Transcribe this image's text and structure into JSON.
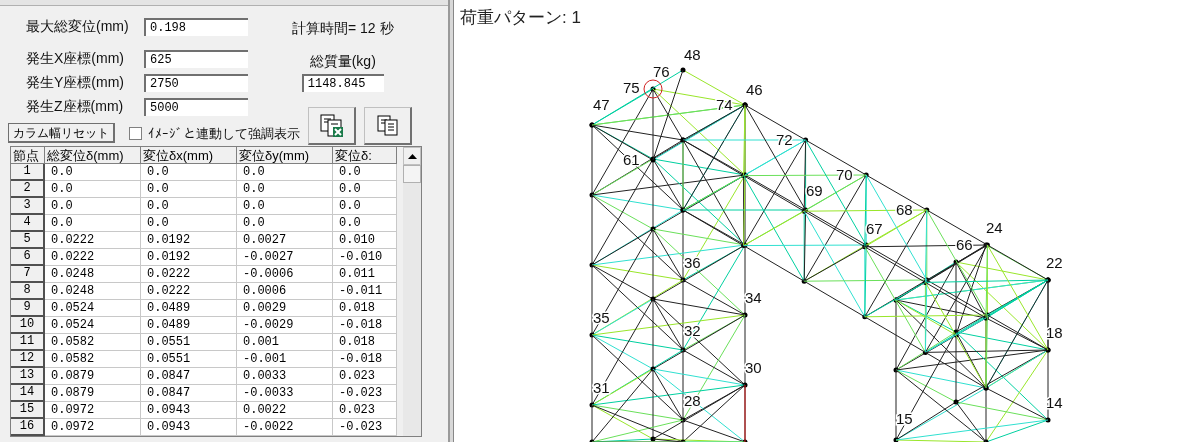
{
  "result_fields": [
    {
      "label": "最大総変位(mm)",
      "value": "0.198"
    },
    {
      "label": "発生X座標(mm)",
      "value": "625"
    },
    {
      "label": "発生Y座標(mm)",
      "value": "2750"
    },
    {
      "label": "発生Z座標(mm)",
      "value": "5000"
    }
  ],
  "calc_time": "計算時間= 12 秒",
  "mass": {
    "label": "総質量(kg)",
    "value": "1148.845"
  },
  "reset_button": "カラム幅リセット",
  "highlight_checkbox": {
    "label": "ｲﾒｰｼﾞと連動して強調表示",
    "checked": false
  },
  "table": {
    "columns": [
      "節点",
      "総変位δ(mm)",
      "変位δx(mm)",
      "変位δy(mm)",
      "変位δ:"
    ],
    "rows": [
      [
        "1",
        "0.0",
        "0.0",
        "0.0",
        "0.0"
      ],
      [
        "2",
        "0.0",
        "0.0",
        "0.0",
        "0.0"
      ],
      [
        "3",
        "0.0",
        "0.0",
        "0.0",
        "0.0"
      ],
      [
        "4",
        "0.0",
        "0.0",
        "0.0",
        "0.0"
      ],
      [
        "5",
        "0.0222",
        "0.0192",
        "0.0027",
        "0.010"
      ],
      [
        "6",
        "0.0222",
        "0.0192",
        "-0.0027",
        "-0.010"
      ],
      [
        "7",
        "0.0248",
        "0.0222",
        "-0.0006",
        "0.011"
      ],
      [
        "8",
        "0.0248",
        "0.0222",
        "0.0006",
        "-0.011"
      ],
      [
        "9",
        "0.0524",
        "0.0489",
        "0.0029",
        "0.018"
      ],
      [
        "10",
        "0.0524",
        "0.0489",
        "-0.0029",
        "-0.018"
      ],
      [
        "11",
        "0.0582",
        "0.0551",
        "0.001",
        "0.018"
      ],
      [
        "12",
        "0.0582",
        "0.0551",
        "-0.001",
        "-0.018"
      ],
      [
        "13",
        "0.0879",
        "0.0847",
        "0.0033",
        "0.023"
      ],
      [
        "14",
        "0.0879",
        "0.0847",
        "-0.0033",
        "-0.023"
      ],
      [
        "15",
        "0.0972",
        "0.0943",
        "0.0022",
        "0.023"
      ],
      [
        "16",
        "0.0972",
        "0.0943",
        "-0.0022",
        "-0.023"
      ]
    ]
  },
  "view": {
    "title": "荷重パターン: 1",
    "node_labels": [
      "48",
      "76",
      "75",
      "46",
      "47",
      "74",
      "72",
      "61",
      "70",
      "69",
      "68",
      "24",
      "67",
      "66",
      "36",
      "22",
      "34",
      "35",
      "32",
      "18",
      "30",
      "31",
      "28",
      "14",
      "15"
    ]
  }
}
